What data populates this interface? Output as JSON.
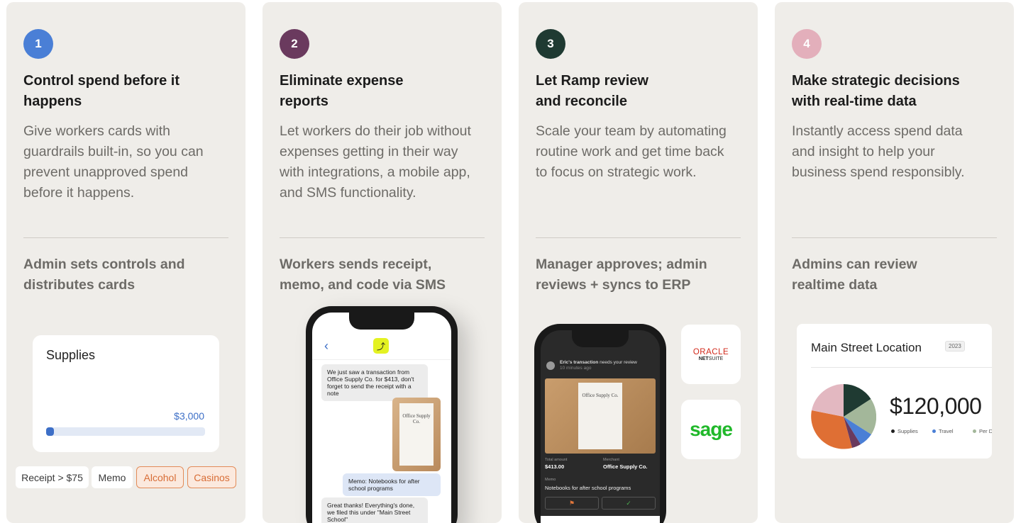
{
  "cards": [
    {
      "number": "1",
      "badge_color": "#4a7fd6",
      "title": "Control spend before it happens",
      "description": "Give workers cards with guardrails built-in, so you can prevent unapproved spend before it happens.",
      "subtitle": "Admin sets controls and distributes cards",
      "widget": {
        "title": "Supplies",
        "amount": "$3,000",
        "progress": 0.05,
        "chips": [
          "Receipt > $75",
          "Memo",
          "Alcohol",
          "Casinos"
        ]
      }
    },
    {
      "number": "2",
      "badge_color": "#6a3a5e",
      "title": "Eliminate expense reports",
      "description": "Let workers do their job without expenses getting in their way with integrations, a mobile app, and SMS functionality.",
      "subtitle": "Workers sends receipt, memo, and code via SMS",
      "sms": {
        "msg1": "We just saw a transaction from Office Supply Co. for $413, don't forget to send the receipt with a note",
        "receipt_name": "Office Supply Co.",
        "memo": "Memo: Notebooks for after school programs",
        "reply": "Great thanks! Everything's done, we filed this under \"Main Street School\""
      }
    },
    {
      "number": "3",
      "badge_color": "#1f3a32",
      "title": "Let Ramp review and reconcile",
      "description": "Scale your team by automating routine work and get time back to focus on strategic work.",
      "subtitle": "Manager approves; admin reviews + syncs to ERP",
      "review": {
        "header_bold": "Eric's transaction",
        "header_rest": " needs your review",
        "time": "10 minutes ago",
        "receipt_name": "Office Supply Co.",
        "total_label": "Total amount",
        "total": "$413.00",
        "merchant_label": "Merchant",
        "merchant": "Office Supply Co.",
        "memo_label": "Memo",
        "memo": "Notebooks for after school programs"
      },
      "logos": {
        "oracle": "ORACLE",
        "netsuite_a": "NET",
        "netsuite_b": "SUITE",
        "sage": "sage"
      }
    },
    {
      "number": "4",
      "badge_color": "#e3afbb",
      "title": "Make strategic decisions with real-time data",
      "description": "Instantly access spend data and insight to help your business spend responsibly.",
      "subtitle": "Admins can review realtime data",
      "data": {
        "title": "Main Street Location",
        "year": "2023",
        "total": "$120,000",
        "legend": [
          "Supplies",
          "Travel",
          "Per Diem"
        ],
        "legend_colors": [
          "#1f1f1f",
          "#4a7fd6",
          "#a3b79a"
        ]
      }
    }
  ]
}
